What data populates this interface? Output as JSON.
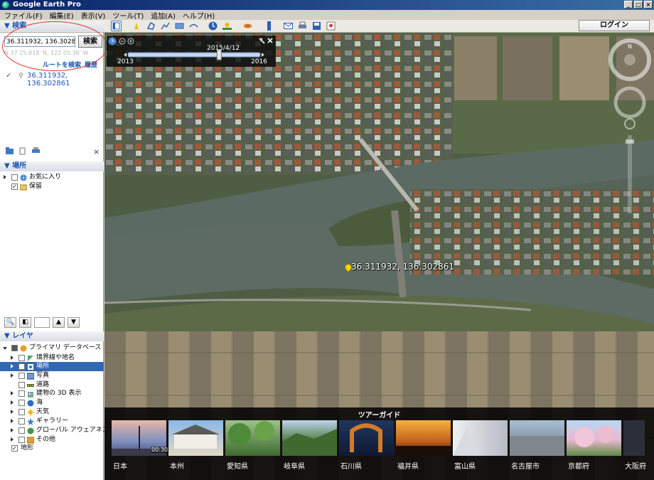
{
  "window": {
    "title": "Google Earth Pro",
    "controls": [
      "_",
      "□",
      "×"
    ]
  },
  "menu": [
    "ファイル(F)",
    "編集(E)",
    "表示(V)",
    "ツール(T)",
    "追加(A)",
    "ヘルプ(H)"
  ],
  "toolbar": {
    "login_label": "ログイン"
  },
  "search_panel": {
    "header": "▼ 検索",
    "query": "36.311932, 136.302861",
    "search_button": "検索",
    "faint_coord": "N 37 25.818' N, 122 05.36' W",
    "route_link": "ルートを検索",
    "history_link": "履歴",
    "result_lines": [
      "36.311932,",
      "136.302861"
    ],
    "close": "×"
  },
  "places_panel": {
    "header": "▼ 場所",
    "items": [
      {
        "label": "お気に入り",
        "icon": "globe-icon",
        "checked": false
      },
      {
        "label": "保留",
        "icon": "folder-icon",
        "checked": true
      }
    ]
  },
  "layers_panel": {
    "header": "▼ レイヤ",
    "items": [
      {
        "label": "プライマリ データベース",
        "icon": "database-icon",
        "level": 0
      },
      {
        "label": "境界線や地名",
        "icon": "border-icon",
        "level": 1
      },
      {
        "label": "場所",
        "icon": "place-icon",
        "level": 1,
        "selected": true
      },
      {
        "label": "写真",
        "icon": "photo-icon",
        "level": 1
      },
      {
        "label": "道路",
        "icon": "road-icon",
        "level": 1
      },
      {
        "label": "建物の 3D 表示",
        "icon": "building-icon",
        "level": 1
      },
      {
        "label": "海",
        "icon": "ocean-icon",
        "level": 1
      },
      {
        "label": "天気",
        "icon": "weather-icon",
        "level": 1
      },
      {
        "label": "ギャラリー",
        "icon": "gallery-icon",
        "level": 1
      },
      {
        "label": "グローバル アウェアネス",
        "icon": "awareness-icon",
        "level": 1
      },
      {
        "label": "その他",
        "icon": "more-icon",
        "level": 1
      },
      {
        "label": "地形",
        "icon": "terrain-icon",
        "level": 0,
        "checked": true
      }
    ]
  },
  "timeline": {
    "date": "2015/4/12",
    "start": "2013",
    "end": "2016",
    "position": 0.69
  },
  "map": {
    "placemark_label": "36.311932, 136.302861"
  },
  "tour_guide": {
    "title": "ツアーガイド",
    "first_duration": "00:30",
    "cards": [
      "日本",
      "本州",
      "愛知県",
      "岐阜県",
      "石川県",
      "福井県",
      "富山県",
      "名古屋市",
      "京都府",
      "大阪府"
    ]
  }
}
